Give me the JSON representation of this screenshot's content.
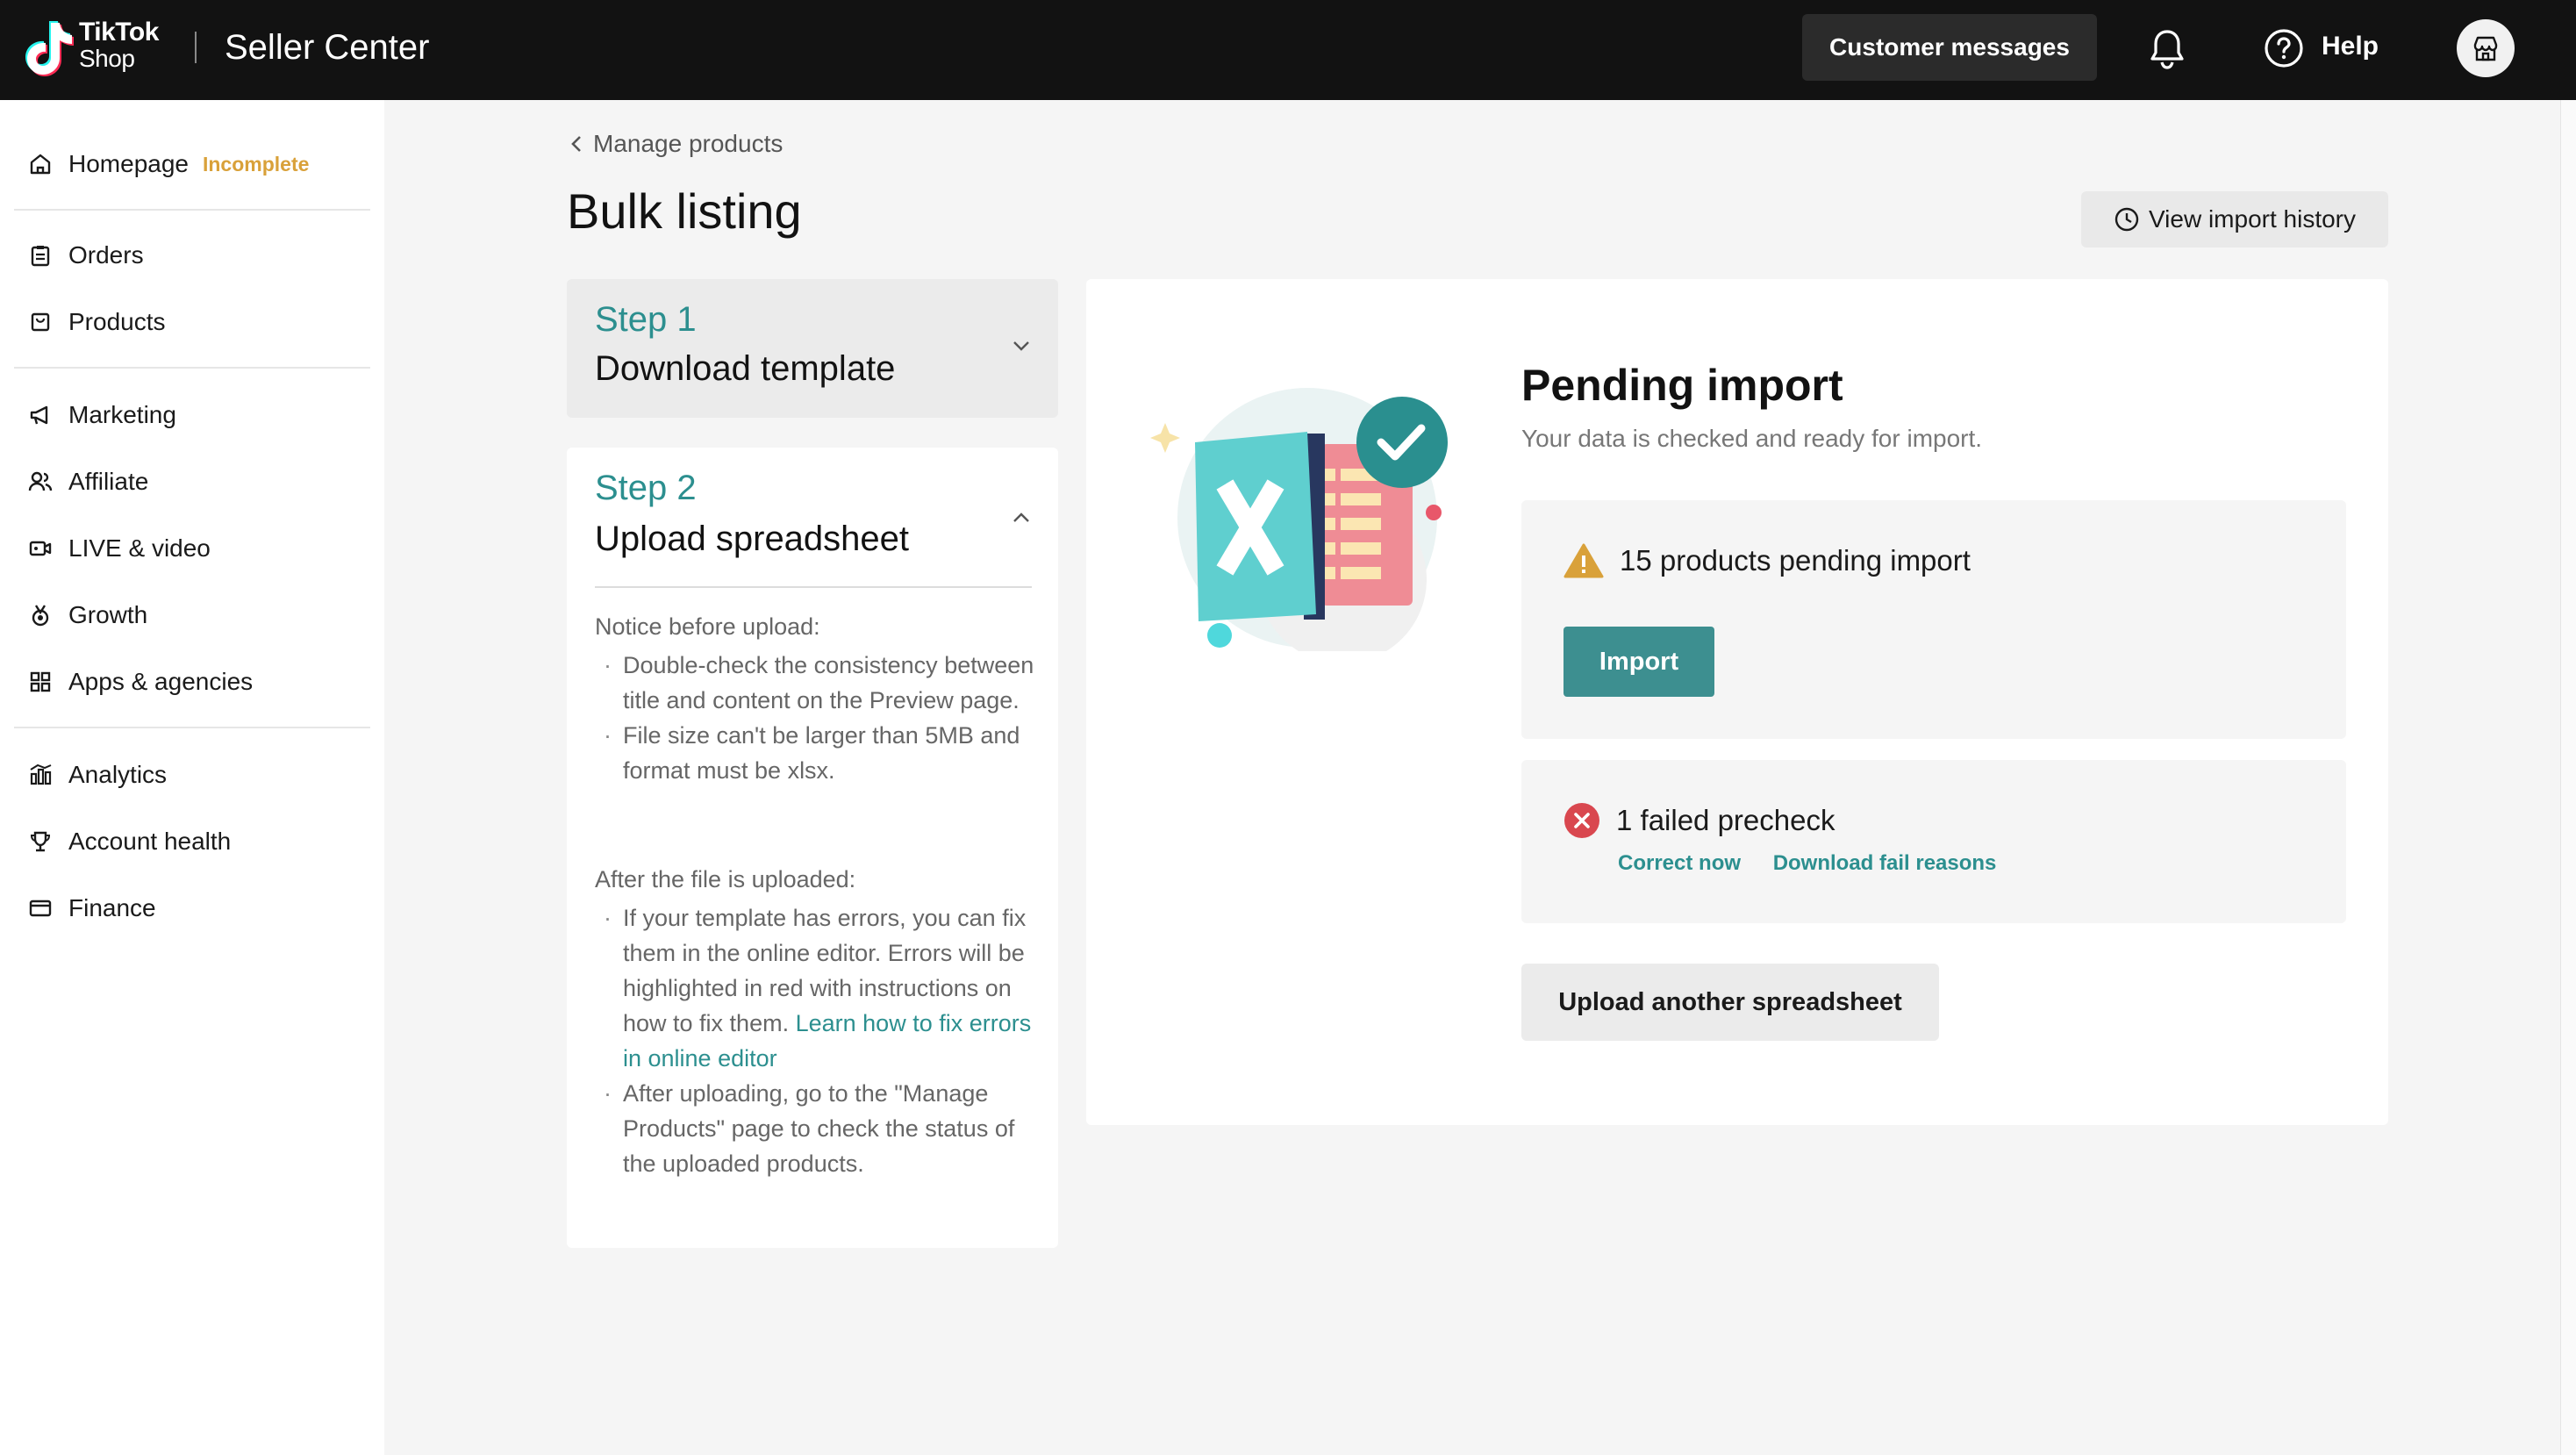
{
  "header": {
    "logo_line1": "TikTok",
    "logo_line2": "Shop",
    "app_name": "Seller Center",
    "customer_messages": "Customer messages",
    "help": "Help"
  },
  "sidebar": {
    "items": [
      {
        "label": "Homepage",
        "icon": "home-icon",
        "badge": "Incomplete"
      },
      {
        "label": "Orders",
        "icon": "clipboard-icon"
      },
      {
        "label": "Products",
        "icon": "box-icon"
      },
      {
        "label": "Marketing",
        "icon": "megaphone-icon"
      },
      {
        "label": "Affiliate",
        "icon": "people-icon"
      },
      {
        "label": "LIVE & video",
        "icon": "video-icon"
      },
      {
        "label": "Growth",
        "icon": "medal-icon"
      },
      {
        "label": "Apps & agencies",
        "icon": "apps-icon"
      },
      {
        "label": "Analytics",
        "icon": "chart-icon"
      },
      {
        "label": "Account health",
        "icon": "trophy-icon"
      },
      {
        "label": "Finance",
        "icon": "card-icon"
      }
    ]
  },
  "main": {
    "breadcrumb": "Manage products",
    "title": "Bulk listing",
    "view_history": "View import history",
    "step1": {
      "num": "Step 1",
      "title": "Download template"
    },
    "step2": {
      "num": "Step 2",
      "title": "Upload spreadsheet",
      "notice_heading": "Notice before upload:",
      "notice_items": [
        "Double-check the consistency between title and content on the Preview page.",
        "File size can't be larger than 5MB and format must be xlsx."
      ],
      "after_heading": "After the file is uploaded:",
      "after_item1": "If your template has errors, you can fix them in the online editor. Errors will be highlighted in red with instructions on how to fix them.",
      "after_item1_link": "Learn how to fix errors in online editor",
      "after_item2": "After uploading, go to the \"Manage Products\" page to check the status of the uploaded products."
    },
    "panel": {
      "title": "Pending import",
      "subtitle": "Your data is checked and ready for import.",
      "pending_text": "15 products pending import",
      "import_button": "Import",
      "failed_text": "1 failed precheck",
      "correct_now": "Correct now",
      "download_fail": "Download fail reasons",
      "upload_another": "Upload another spreadsheet"
    }
  },
  "colors": {
    "accent": "#3d8f90",
    "warning": "#d9a13a",
    "error": "#d9474f"
  }
}
